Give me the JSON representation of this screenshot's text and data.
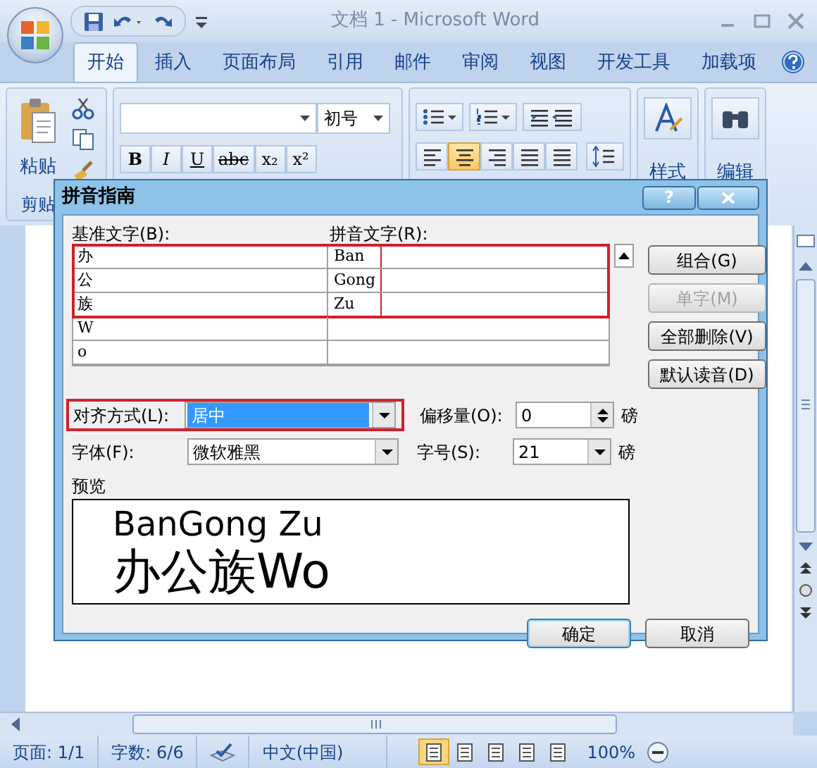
{
  "window": {
    "title": "文档 1 - Microsoft Word"
  },
  "tabs": [
    {
      "label": "开始",
      "selected": true
    },
    {
      "label": "插入",
      "selected": false
    },
    {
      "label": "页面布局",
      "selected": false
    },
    {
      "label": "引用",
      "selected": false
    },
    {
      "label": "邮件",
      "selected": false
    },
    {
      "label": "审阅",
      "selected": false
    },
    {
      "label": "视图",
      "selected": false
    },
    {
      "label": "开发工具",
      "selected": false
    },
    {
      "label": "加载项",
      "selected": false
    }
  ],
  "ribbon": {
    "paste_label": "粘贴",
    "clipboard_group": "剪贴",
    "font_size": "初号",
    "format_buttons": [
      "B",
      "I",
      "U",
      "abc",
      "x₂",
      "x²"
    ],
    "align_buttons": [
      {
        "selected": false
      },
      {
        "selected": true
      },
      {
        "selected": false
      },
      {
        "selected": false
      },
      {
        "selected": false
      }
    ],
    "styles_label": "样式",
    "editing_label": "编辑"
  },
  "dialog": {
    "title": "拼音指南",
    "help": "?",
    "base_label": "基准文字(B):",
    "ruby_label": "拼音文字(R):",
    "rows": [
      {
        "base": "办",
        "ruby": "Ban",
        "highlighted": true
      },
      {
        "base": "公",
        "ruby": "Gong",
        "highlighted": true
      },
      {
        "base": "族",
        "ruby": "Zu",
        "highlighted": true
      },
      {
        "base": "W",
        "highlighted": false
      },
      {
        "base": "o",
        "highlighted": false
      }
    ],
    "buttons": [
      {
        "label": "组合(G)",
        "disabled": false
      },
      {
        "label": "单字(M)",
        "disabled": true
      },
      {
        "label": "全部删除(V)",
        "disabled": false
      },
      {
        "label": "默认读音(D)",
        "disabled": false
      }
    ],
    "alignment": {
      "label": "对齐方式(L):",
      "value": "居中",
      "highlighted": true
    },
    "offset": {
      "label": "偏移量(O):",
      "value": "0",
      "unit": "磅"
    },
    "font": {
      "label": "字体(F):",
      "value": "微软雅黑"
    },
    "size": {
      "label": "字号(S):",
      "value": "21",
      "unit": "磅"
    },
    "preview": {
      "label": "预览",
      "ruby": "BanGong Zu",
      "base": "办公族Wo"
    },
    "ok": "确定",
    "cancel": "取消"
  },
  "status_bar": {
    "page": "页面: 1/1",
    "words": "字数: 6/6",
    "language": "中文(中国)",
    "zoom": "100%",
    "views": [
      {
        "selected": true
      },
      {
        "selected": false
      },
      {
        "selected": false
      },
      {
        "selected": false
      },
      {
        "selected": false
      }
    ]
  }
}
